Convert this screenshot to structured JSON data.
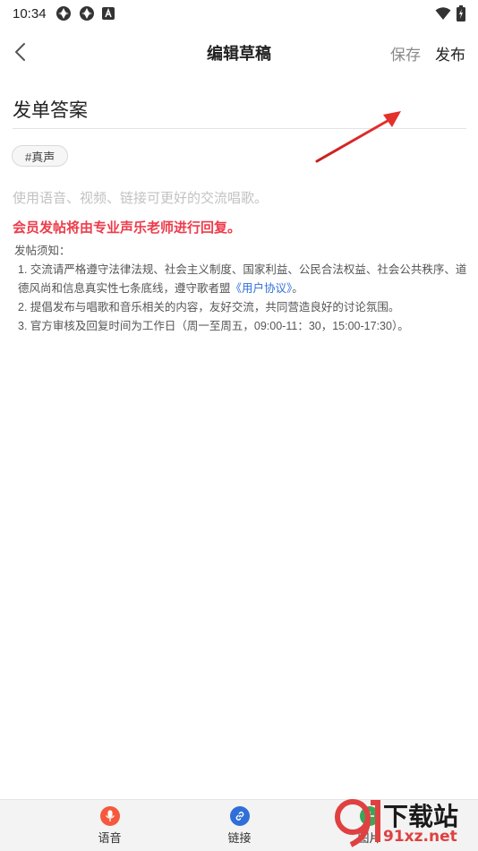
{
  "status_bar": {
    "time": "10:34"
  },
  "header": {
    "title": "编辑草稿",
    "save_label": "保存",
    "publish_label": "发布"
  },
  "editor": {
    "title_value": "发单答案",
    "tag": "#真声",
    "content_placeholder": "使用语音、视频、链接可更好的交流唱歌。",
    "member_notice": "会员发帖将由专业声乐老师进行回复。"
  },
  "rules": {
    "heading": "发帖须知：",
    "rule1_prefix": "1. 交流请严格遵守法律法规、社会主义制度、国家利益、公民合法权益、社会公共秩序、道德风尚和信息真实性七条底线，遵守歌者盟",
    "rule1_link": "《用户协议》",
    "rule1_suffix": "。",
    "rule2": "2. 提倡发布与唱歌和音乐相关的内容，友好交流，共同营造良好的讨论氛围。",
    "rule3": "3. 官方审核及回复时间为工作日（周一至周五，09:00-11：30，15:00-17:30）。"
  },
  "toolbar": {
    "voice_label": "语音",
    "link_label": "链接",
    "image_label": "图片"
  },
  "watermark": {
    "text_main": "下载站",
    "text_site": "91xz.net"
  },
  "colors": {
    "accent_red": "#ee3b4a",
    "link_blue": "#2f6fd8",
    "voice_orange": "#f5593d",
    "link_icon_blue": "#2f6fd8",
    "image_green": "#3aa65a"
  }
}
